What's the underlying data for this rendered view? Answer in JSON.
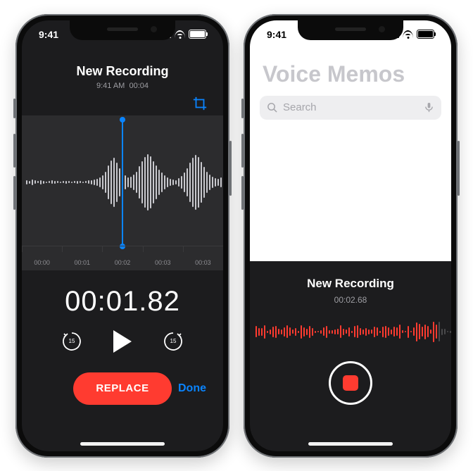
{
  "status": {
    "time": "9:41"
  },
  "left": {
    "title": "New Recording",
    "meta_time": "9:41 AM",
    "meta_duration": "00:04",
    "bigTime": "00:01.82",
    "skip_seconds": "15",
    "replace_label": "REPLACE",
    "done_label": "Done",
    "ticks": [
      "00:00",
      "00:01",
      "00:02",
      "00:03",
      "00:03"
    ]
  },
  "right": {
    "app_title": "Voice Memos",
    "search_placeholder": "Search",
    "recording_title": "New Recording",
    "recording_time": "00:02.68"
  },
  "colors": {
    "accent": "#0a84ff",
    "record": "#ff3b30"
  }
}
